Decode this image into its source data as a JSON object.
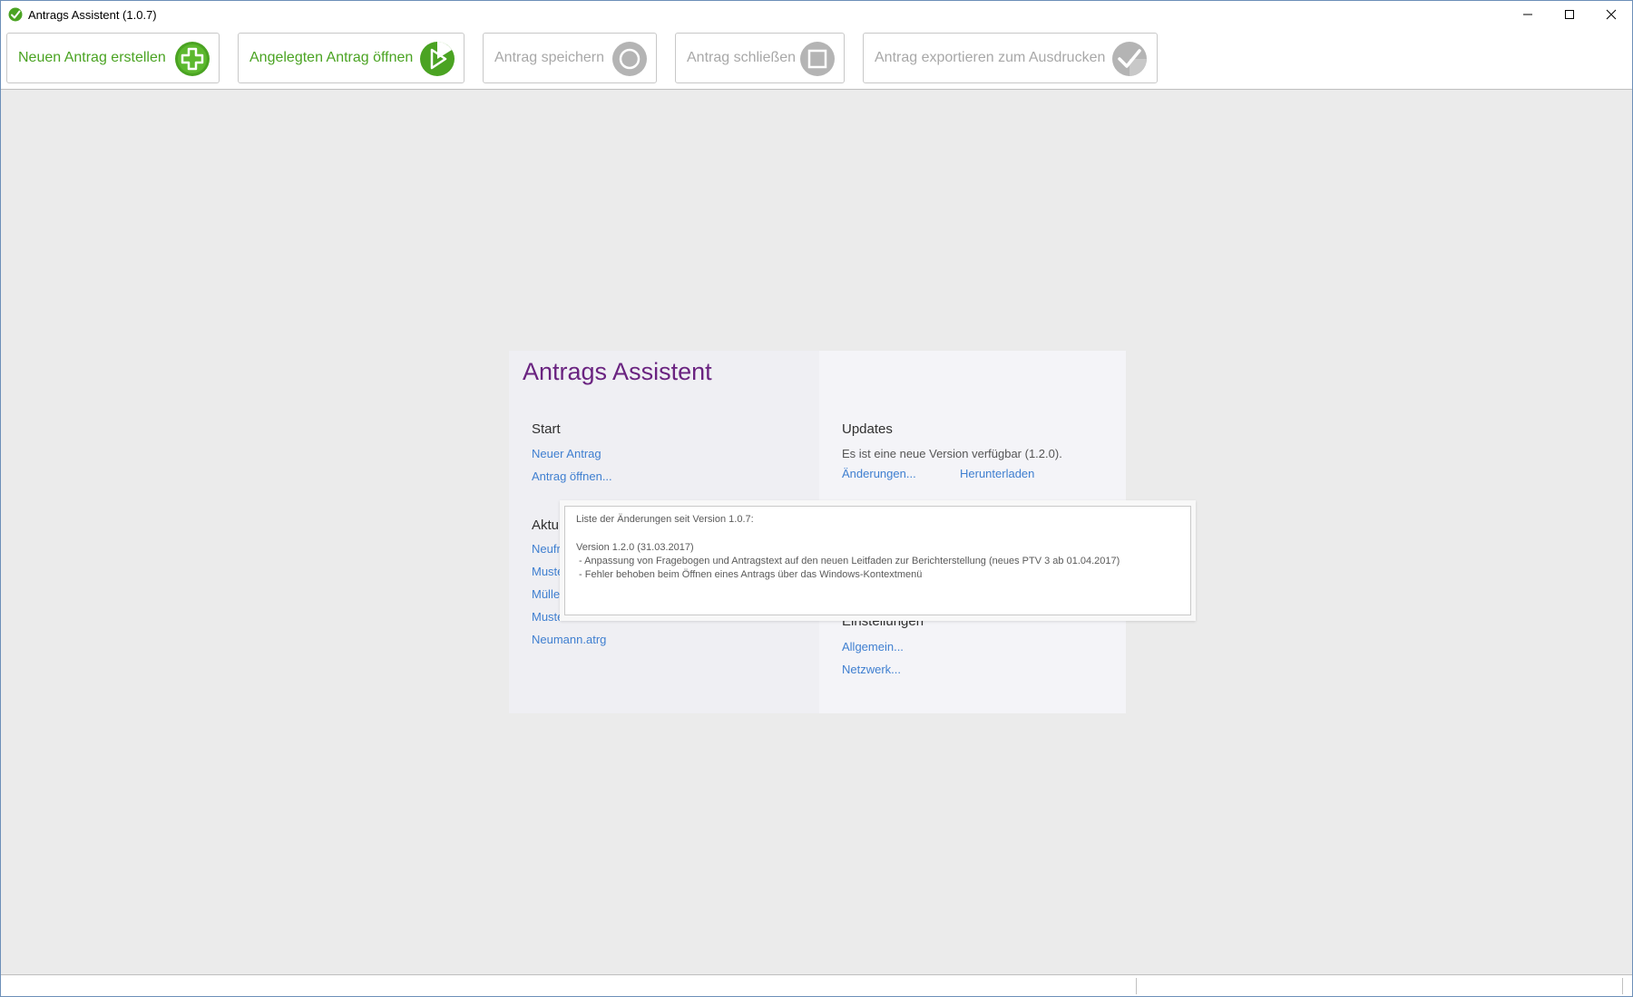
{
  "window": {
    "title": "Antrags Assistent (1.0.7)"
  },
  "toolbar": {
    "buttons": [
      {
        "label": "Neuen Antrag erstellen",
        "icon": "plus-circle-icon",
        "enabled": true
      },
      {
        "label": "Angelegten Antrag öffnen",
        "icon": "open-play-icon",
        "enabled": true
      },
      {
        "label": "Antrag speichern",
        "icon": "save-circle-icon",
        "enabled": false
      },
      {
        "label": "Antrag schließen",
        "icon": "close-square-icon",
        "enabled": false
      },
      {
        "label": "Antrag exportieren zum Ausdrucken",
        "icon": "checkmark-icon",
        "enabled": false
      }
    ]
  },
  "start_page": {
    "heading": "Antrags Assistent",
    "start": {
      "title": "Start",
      "links": [
        "Neuer Antrag",
        "Antrag öffnen..."
      ]
    },
    "recent": {
      "title_visible": "Aktu",
      "items_visible": [
        "Neufr",
        "Muste",
        "Mülle",
        "Muste",
        "Neumann.atrg"
      ]
    },
    "updates": {
      "title": "Updates",
      "message": "Es ist eine neue Version verfügbar (1.2.0).",
      "changes_link": "Änderungen...",
      "download_link": "Herunterladen"
    },
    "settings": {
      "title": "Einstellungen",
      "links": [
        "Allgemein...",
        "Netzwerk..."
      ]
    }
  },
  "tooltip": {
    "header": "Liste der Änderungen seit Version 1.0.7:",
    "version_line": "Version 1.2.0 (31.03.2017)",
    "changes": [
      " - Anpassung von Fragebogen und Antragstext auf den neuen Leitfaden zur Berichterstellung (neues PTV 3 ab 01.04.2017)",
      " - Fehler behoben beim Öffnen eines Antrags über das Windows-Kontextmenü"
    ]
  },
  "colors": {
    "accent_green": "#4aa322",
    "heading_purple": "#6a2380",
    "link_blue": "#3f7fd0",
    "disabled_gray": "#a8a8a8"
  }
}
